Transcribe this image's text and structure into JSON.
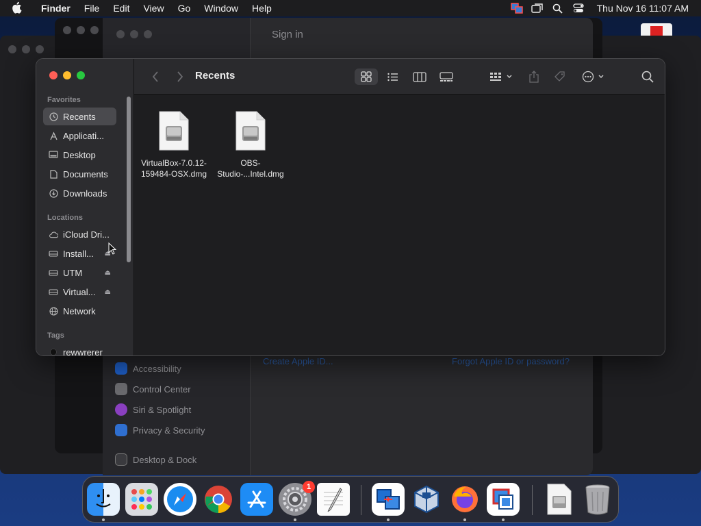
{
  "menubar": {
    "app_name": "Finder",
    "items": [
      "File",
      "Edit",
      "View",
      "Go",
      "Window",
      "Help"
    ],
    "clock": "Thu Nov 16  11:07 AM",
    "status_icons": [
      "screen-share-icon",
      "mirror-icon",
      "spotlight-icon",
      "control-center-icon"
    ]
  },
  "background": {
    "settings_window_title": "Sign in",
    "settings_items": [
      "Accessibility",
      "Control Center",
      "Siri & Spotlight",
      "Privacy & Security",
      "Desktop & Dock"
    ],
    "create_link": "Create Apple ID...",
    "forgot_link": "Forgot Apple ID or password?"
  },
  "finder": {
    "title": "Recents",
    "sidebar": {
      "favorites_header": "Favorites",
      "favorites": [
        {
          "label": "Recents",
          "icon": "clock-icon",
          "selected": true
        },
        {
          "label": "Applicati...",
          "icon": "applications-icon"
        },
        {
          "label": "Desktop",
          "icon": "desktop-icon"
        },
        {
          "label": "Documents",
          "icon": "document-icon"
        },
        {
          "label": "Downloads",
          "icon": "download-icon"
        }
      ],
      "locations_header": "Locations",
      "locations": [
        {
          "label": "iCloud Dri...",
          "icon": "cloud-icon"
        },
        {
          "label": "Install...",
          "icon": "drive-icon",
          "eject": true
        },
        {
          "label": "UTM",
          "icon": "drive-icon",
          "eject": true
        },
        {
          "label": "Virtual...",
          "icon": "drive-icon",
          "eject": true
        },
        {
          "label": "Network",
          "icon": "globe-icon"
        }
      ],
      "tags_header": "Tags",
      "tags": [
        {
          "label": "rewwrerer",
          "color": "#111111"
        }
      ]
    },
    "files": [
      {
        "name_line1": "VirtualBox-7.0.12-",
        "name_line2": "159484-OSX.dmg"
      },
      {
        "name_line1": "OBS-",
        "name_line2": "Studio-...Intel.dmg"
      }
    ]
  },
  "dock": {
    "apps": [
      "finder-icon",
      "launchpad-icon",
      "safari-icon",
      "chrome-icon",
      "app-store-icon",
      "system-settings-icon",
      "textedit-icon",
      "screen-sharing-icon",
      "virtualbox-icon",
      "firefox-icon",
      "remote-desktop-icon",
      "disk-image-icon",
      "trash-icon"
    ],
    "settings_badge": "1"
  },
  "colors": {
    "close": "#ff5f57",
    "minimize": "#febc2e",
    "maximize": "#28c840",
    "link": "#2c5da8"
  }
}
